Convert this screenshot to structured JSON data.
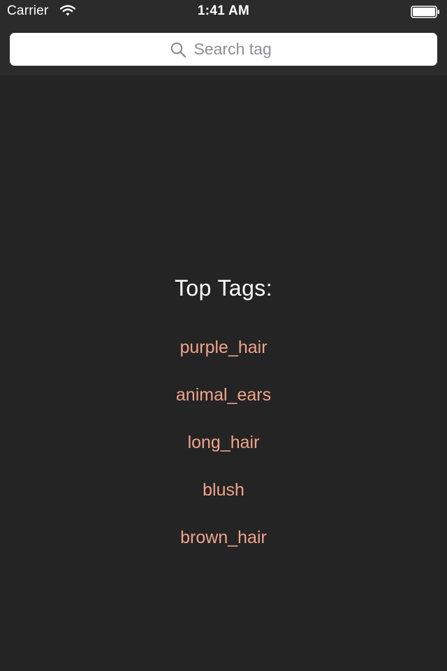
{
  "status_bar": {
    "carrier": "Carrier",
    "time": "1:41 AM"
  },
  "search": {
    "placeholder": "Search tag",
    "value": ""
  },
  "top_tags": {
    "title": "Top Tags:",
    "items": [
      "purple_hair",
      "animal_ears",
      "long_hair",
      "blush",
      "brown_hair"
    ]
  },
  "colors": {
    "background": "#242424",
    "header_background": "#2b2b2b",
    "tag_text": "#f0a48a",
    "title_text": "#ffffff"
  },
  "icons": {
    "status": [
      "wifi-icon",
      "battery-icon"
    ],
    "search": "search-icon"
  }
}
